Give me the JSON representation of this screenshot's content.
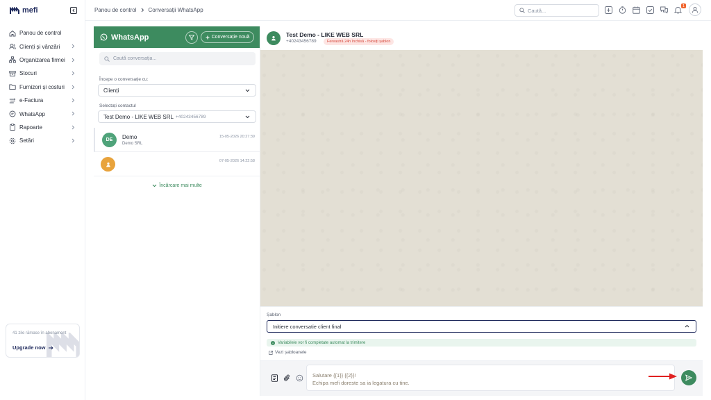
{
  "app": {
    "logo_text": "mefi"
  },
  "sidebar": {
    "items": [
      {
        "label": "Panou de control",
        "icon": "home-icon",
        "chevron": false
      },
      {
        "label": "Clienți și vânzări",
        "icon": "users-icon",
        "chevron": true
      },
      {
        "label": "Organizarea firmei",
        "icon": "org-icon",
        "chevron": true
      },
      {
        "label": "Stocuri",
        "icon": "box-icon",
        "chevron": true
      },
      {
        "label": "Furnizori și costuri",
        "icon": "folder-icon",
        "chevron": true
      },
      {
        "label": "e-Factura",
        "icon": "efactura-icon",
        "chevron": true
      },
      {
        "label": "WhatsApp",
        "icon": "chat-icon",
        "chevron": true
      },
      {
        "label": "Rapoarte",
        "icon": "clipboard-icon",
        "chevron": true
      },
      {
        "label": "Setări",
        "icon": "gear-icon",
        "chevron": true
      }
    ],
    "promo": {
      "text": "41 zile rămase în abonament",
      "button": "Upgrade now"
    }
  },
  "topbar": {
    "breadcrumb": [
      "Panou de control",
      "Conversații WhatsApp"
    ],
    "search_placeholder": "Caută...",
    "notification_count": "1"
  },
  "conversations": {
    "header_title": "WhatsApp",
    "new_button": "Conversație nouă",
    "search_placeholder": "Caută conversația...",
    "start_label": "Începe o conversație cu:",
    "start_value": "Clienți",
    "contact_label": "Selectați contactul",
    "contact_value": "Test Demo - LIKE WEB SRL",
    "contact_phone": "+40243456789",
    "items": [
      {
        "initials": "DE",
        "name": "Demo",
        "subtitle": "Demo SRL",
        "time": "15-05-2026 20:27:39",
        "color": "#4fa37a"
      },
      {
        "initials": "",
        "name": "",
        "subtitle": "",
        "time": "07-05-2026 14:22:58",
        "color": "#e8a33c"
      }
    ],
    "load_more": "Încărcare mai multe"
  },
  "chat": {
    "contact_name": "Test Demo - LIKE WEB SRL",
    "contact_phone": "+40243456789",
    "window_status": "Fereastră 24h închisă - folosiți șablon",
    "template_label": "Șablon",
    "template_value": "Initiere conversatie client final",
    "info_text": "Variabilele vor fi completate automat la trimitere",
    "templates_link": "Vezi șabloanele",
    "message_lines": [
      "Salutare {{1}} {{2}}!",
      "Echipa mefi doreste sa ia legatura cu tine."
    ]
  },
  "colors": {
    "brand": "#3d8b5f",
    "navy": "#1f2a5c",
    "warn": "#d64a3e",
    "annotation": "#e02020"
  }
}
